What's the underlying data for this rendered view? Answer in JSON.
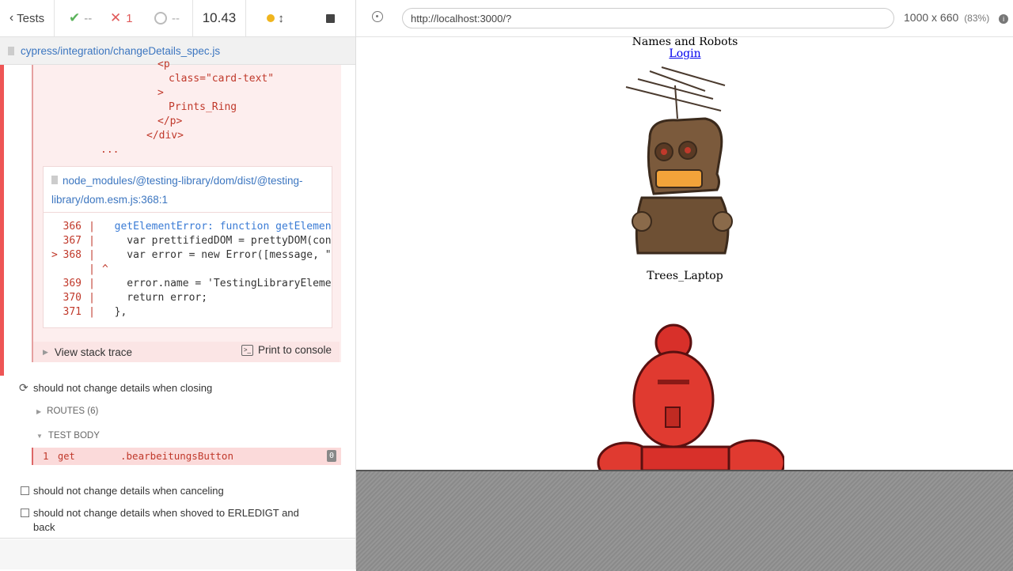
{
  "reporter": {
    "stats": {
      "tests_label": "Tests",
      "passed": "--",
      "failed": "1",
      "pending": "--",
      "duration": "10.43"
    },
    "spec_path": "cypress/integration/changeDetails_spec.js",
    "error": {
      "dom_lines": [
        "<p",
        "class=\"card-text\"",
        ">",
        "Prints_Ring",
        "</p>",
        "</div>",
        "..."
      ],
      "file_link": "node_modules/@testing-library/dom/dist/@testing-library/dom.esm.js:368:1",
      "code": [
        {
          "num": "366",
          "marker": "",
          "text": "  getElementError: function getElement"
        },
        {
          "num": "367",
          "marker": "",
          "text": "    var prettifiedDOM = prettyDOM(cont"
        },
        {
          "num": "368",
          "marker": ">",
          "text": "    var error = new Error([message, \"I"
        },
        {
          "num": "",
          "marker": "",
          "text": "^"
        },
        {
          "num": "369",
          "marker": "",
          "text": "    error.name = 'TestingLibraryElemen"
        },
        {
          "num": "370",
          "marker": "",
          "text": "    return error;"
        },
        {
          "num": "371",
          "marker": "",
          "text": "  },"
        }
      ],
      "stack_label": "View stack trace",
      "print_label": "Print to console"
    },
    "tests": {
      "closing": "should not change details when closing",
      "routes": "ROUTES (6)",
      "test_body": "TEST BODY",
      "command": {
        "index": "1",
        "name": "get",
        "message": ".bearbeitungsButton",
        "badge": "0"
      },
      "canceling": "should not change details when canceling",
      "erledigt_1": "should not change details when shoved to ERLEDIGT and",
      "erledigt_2": "back"
    }
  },
  "aut": {
    "url": "http://localhost:3000/?",
    "viewport": "1000 x 660",
    "scale": "(83%)",
    "page": {
      "title": "Names and Robots",
      "login": "Login",
      "card_name": "Trees_Laptop"
    }
  },
  "colors": {
    "fail": "#e55555",
    "link": "#3c76c0",
    "running": "#f0b51e"
  }
}
